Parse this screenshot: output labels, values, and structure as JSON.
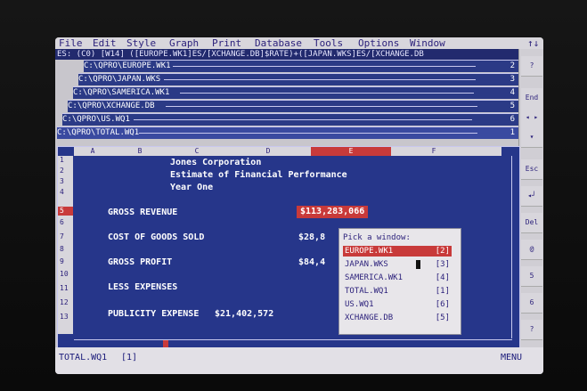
{
  "menu": [
    "File",
    "Edit",
    "Style",
    "Graph",
    "Print",
    "Database",
    "Tools",
    "Options",
    "Window"
  ],
  "menu_corner": "↑↓",
  "input_line": "ES: (C0) [W14] ([EUROPE.WK1]ES/[XCHANGE.DB]$RATE)+([JAPAN.WKS]ES/[XCHANGE.DB",
  "side_buttons": [
    "?",
    "End",
    "◂ ▸",
    "▾",
    "Esc",
    "◂┘",
    "Del",
    "@",
    "5",
    "6",
    "?"
  ],
  "windows": [
    {
      "path": "C:\\QPRO\\EUROPE.WK1",
      "num": "2"
    },
    {
      "path": "C:\\QPRO\\JAPAN.WKS",
      "num": "3"
    },
    {
      "path": "C:\\QPRO\\SAMERICA.WK1",
      "num": "4"
    },
    {
      "path": "C:\\QPRO\\XCHANGE.DB",
      "num": "5"
    },
    {
      "path": "C:\\QPRO\\US.WQ1",
      "num": "6"
    },
    {
      "path": "C:\\QPRO\\TOTAL.WQ1",
      "num": "1"
    }
  ],
  "sheet": {
    "columns": [
      "A",
      "B",
      "C",
      "D",
      "E",
      "F"
    ],
    "rows": [
      "1",
      "2",
      "3",
      "4",
      "5",
      "6",
      "7",
      "8",
      "9",
      "10",
      "11",
      "12",
      "13"
    ],
    "title1": "Jones Corporation",
    "title2": "Estimate of Financial Performance",
    "title3": "Year One",
    "label_revenue": "GROSS REVENUE",
    "value_revenue": "$113,283,066",
    "label_cogs": "COST OF GOODS SOLD",
    "value_cogs": "$28,8",
    "label_profit": "GROSS PROFIT",
    "value_profit": "$84,4",
    "label_expenses": "LESS EXPENSES",
    "label_publicity": "PUBLICITY EXPENSE",
    "value_publicity": "$21,402,572"
  },
  "picker": {
    "title": "Pick a window:",
    "items": [
      {
        "name": "EUROPE.WK1",
        "num": "[2]"
      },
      {
        "name": "JAPAN.WKS",
        "num": "[3]"
      },
      {
        "name": "SAMERICA.WK1",
        "num": "[4]"
      },
      {
        "name": "TOTAL.WQ1",
        "num": "[1]"
      },
      {
        "name": "US.WQ1",
        "num": "[6]"
      },
      {
        "name": "XCHANGE.DB",
        "num": "[5]"
      }
    ]
  },
  "status": {
    "file": "TOTAL.WQ1",
    "win": "[1]",
    "mode": "MENU"
  }
}
